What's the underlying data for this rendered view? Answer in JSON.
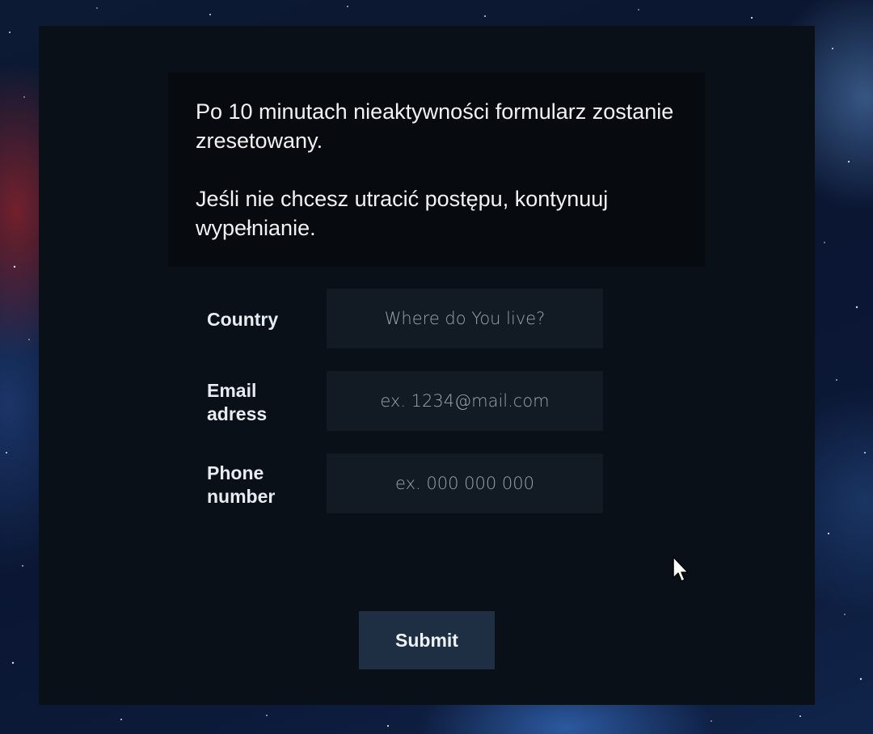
{
  "notice": {
    "line1": "Po 10 minutach nieaktywności formularz zostanie zresetowany.",
    "line2": "Jeśli nie chcesz utracić postępu, kontynuuj wypełnianie."
  },
  "form": {
    "country": {
      "label": "Country",
      "placeholder": "Where do You live?"
    },
    "email": {
      "label": "Email adress",
      "placeholder": "ex. 1234@mail.com"
    },
    "phone": {
      "label": "Phone number",
      "placeholder": "ex. 000 000 000"
    },
    "submit_label": "Submit"
  },
  "colors": {
    "panel": "#0a1018",
    "notice_bg": "#070b10",
    "field_bg": "#121b24",
    "button_bg": "#1e2f44",
    "text": "#f2f2f2"
  }
}
